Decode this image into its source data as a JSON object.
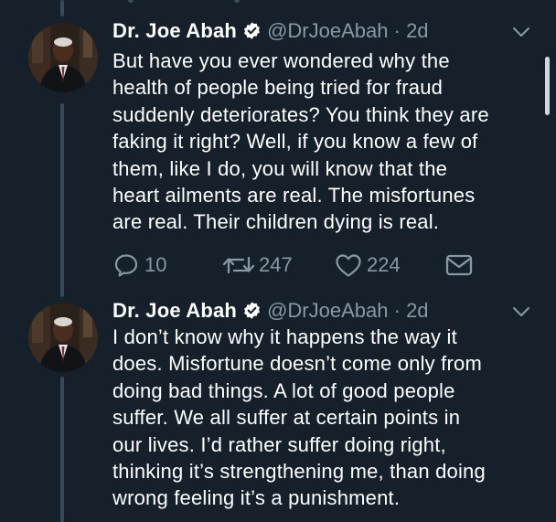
{
  "tweets": [
    {
      "display_name": "Dr. Joe Abah",
      "handle": "@DrJoeAbah",
      "separator": "·",
      "time": "2d",
      "lines": [
        "But have you ever wondered why the",
        "health of people being tried for fraud",
        "suddenly deteriorates? You think they are",
        "faking it right? Well, if you know a few of",
        "them, like I do, you will know that the",
        "heart ailments are real. The misfortunes",
        "are real. Their children dying is real."
      ],
      "actions": {
        "reply_count": "10",
        "retweet_count": "247",
        "like_count": "224"
      }
    },
    {
      "display_name": "Dr. Joe Abah",
      "handle": "@DrJoeAbah",
      "separator": "·",
      "time": "2d",
      "lines": [
        "I don’t know why it happens the way it",
        "does. Misfortune doesn’t come only from",
        "doing bad things. A lot of good people",
        "suffer. We all suffer at certain points in",
        "our lives. I’d rather suffer doing right,",
        "thinking it’s strengthening me, than doing",
        "wrong feeling it’s a punishment."
      ]
    }
  ],
  "icons": {
    "verified": "verified-badge-icon",
    "menu": "chevron-down-icon",
    "reply": "speech-bubble-icon",
    "retweet": "retweet-arrows-icon",
    "like": "heart-icon",
    "message": "envelope-icon"
  },
  "colors": {
    "background": "#15202b",
    "text_primary": "#ffffff",
    "text_secondary": "#8899a6",
    "thread_line": "#3a4958"
  }
}
